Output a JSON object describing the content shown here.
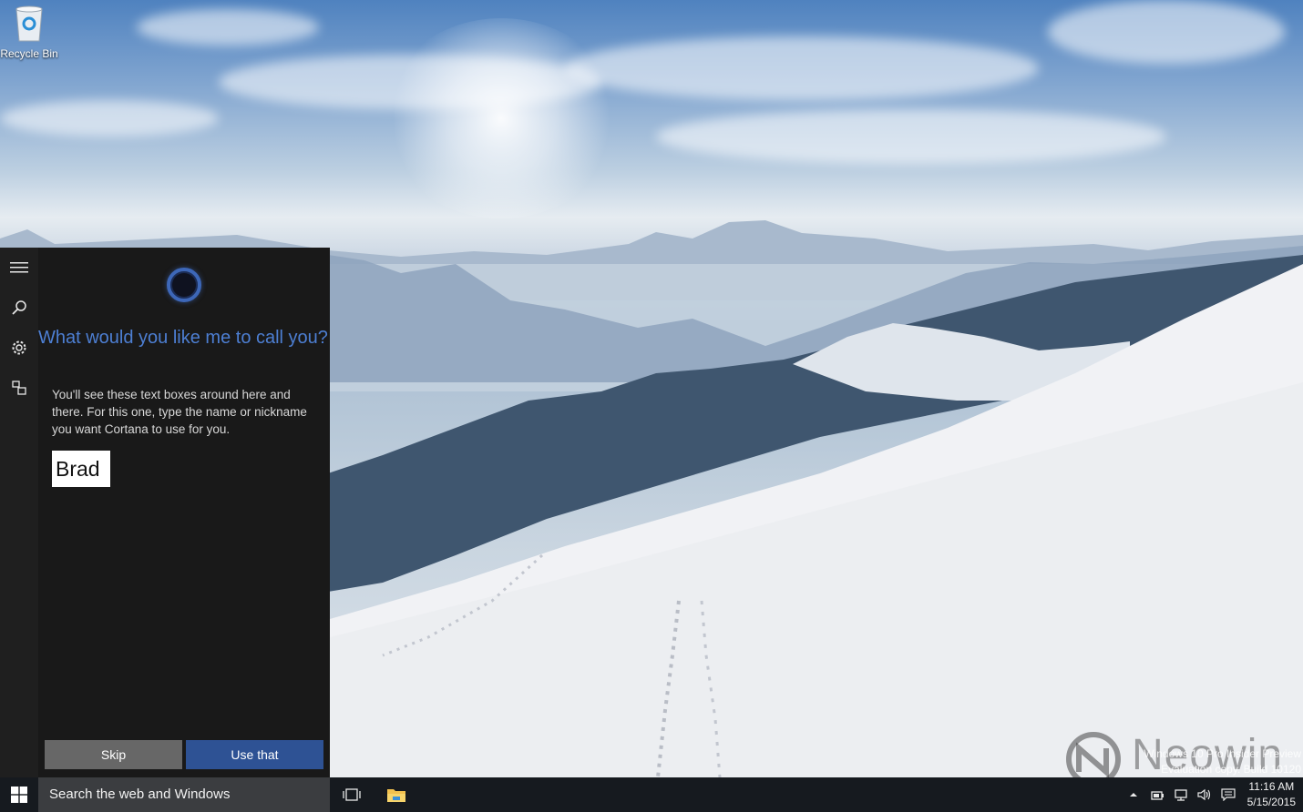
{
  "desktop": {
    "recycle_bin_label": "Recycle Bin",
    "watermark_line1": "Windows 10 Pro Insider Preview",
    "watermark_line2": "Evaluation copy. Build 10120",
    "neowin_logo_text": "Neowin"
  },
  "cortana": {
    "rail_icons": [
      "hamburger-menu-icon",
      "search-icon",
      "gear-icon",
      "feedback-icon"
    ],
    "question": "What would you like me to call you?",
    "help_text": "You'll see these text boxes around here and there. For this one, type the name or nickname you want Cortana to use for you.",
    "name_value": "Brad",
    "skip_label": "Skip",
    "use_label": "Use that",
    "accent_color": "#2e5294"
  },
  "taskbar": {
    "search_placeholder": "Search the web and Windows",
    "time": "11:16 AM",
    "date": "5/15/2015",
    "tray_icons": [
      "chevron-up-icon",
      "power-icon",
      "network-icon",
      "volume-icon",
      "action-center-icon"
    ]
  }
}
